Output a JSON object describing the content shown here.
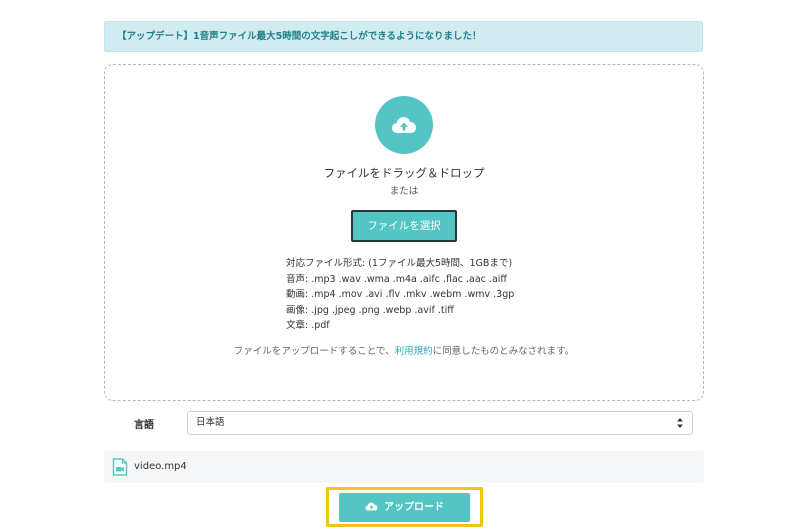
{
  "notice": {
    "text": "【アップデート】1音声ファイル最大5時間の文字起こしができるようになりました！"
  },
  "dropzone": {
    "icon": "cloud-upload-icon",
    "drag_text": "ファイルをドラッグ＆ドロップ",
    "or_text": "または",
    "select_button_label": "ファイルを選択",
    "formats": {
      "header": "対応ファイル形式: (1ファイル最大5時間、1GBまで)",
      "audio": "音声: .mp3 .wav .wma .m4a .aifc .flac .aac .aiff",
      "video": "動画: .mp4 .mov .avi .flv .mkv .webm .wmv .3gp",
      "image": "画像: .jpg .jpeg .png .webp .avif .tiff",
      "document": "文章: .pdf"
    },
    "terms": {
      "before": "ファイルをアップロードすることで、",
      "link": "利用規約",
      "after": "に同意したものとみなされます。"
    }
  },
  "language": {
    "label": "言語",
    "selected": "日本語"
  },
  "file": {
    "icon": "video-file-icon",
    "name": "video.mp4"
  },
  "upload_button": {
    "icon": "cloud-upload-icon",
    "label": "アップロード"
  },
  "colors": {
    "accent": "#53c5c4",
    "notice_bg": "#d1ecf1",
    "notice_text": "#1f7f8a",
    "highlight": "#f0c419"
  }
}
